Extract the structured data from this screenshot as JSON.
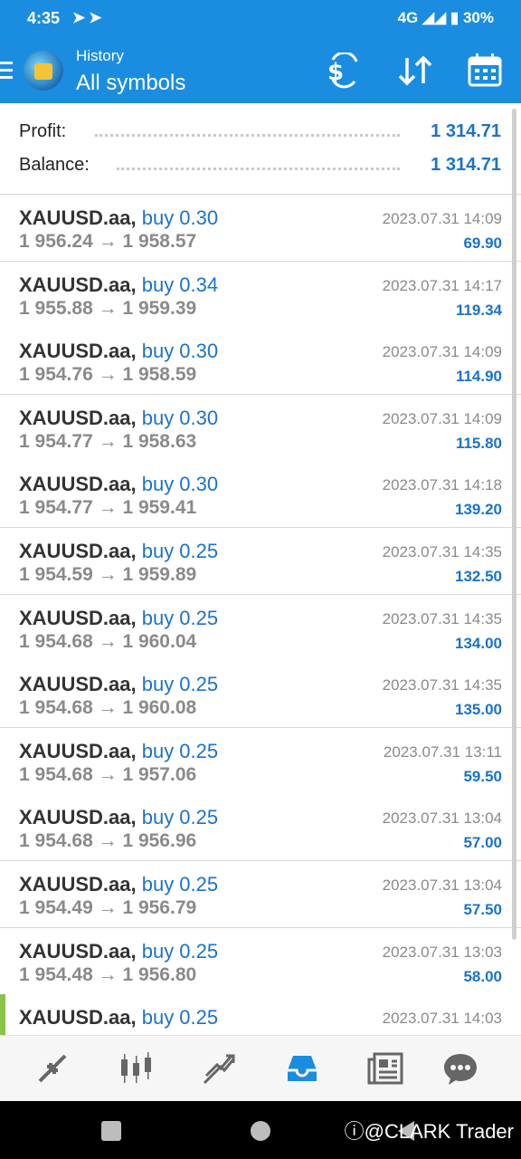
{
  "status_bar": {
    "time": "4:35",
    "network": "4G",
    "battery": "30%"
  },
  "app_bar": {
    "subtitle": "History",
    "title": "All symbols"
  },
  "summary": {
    "profit_label": "Profit:",
    "profit_value": "1 314.71",
    "balance_label": "Balance:",
    "balance_value": "1 314.71"
  },
  "trades": [
    {
      "symbol": "XAUUSD.aa,",
      "action": "buy 0.30",
      "open": "1 956.24",
      "close": "1 958.57",
      "time": "2023.07.31 14:09",
      "profit": "69.90"
    },
    {
      "symbol": "XAUUSD.aa,",
      "action": "buy 0.34",
      "open": "1 955.88",
      "close": "1 959.39",
      "time": "2023.07.31 14:17",
      "profit": "119.34"
    },
    {
      "symbol": "XAUUSD.aa,",
      "action": "buy 0.30",
      "open": "1 954.76",
      "close": "1 958.59",
      "time": "2023.07.31 14:09",
      "profit": "114.90"
    },
    {
      "symbol": "XAUUSD.aa,",
      "action": "buy 0.30",
      "open": "1 954.77",
      "close": "1 958.63",
      "time": "2023.07.31 14:09",
      "profit": "115.80"
    },
    {
      "symbol": "XAUUSD.aa,",
      "action": "buy 0.30",
      "open": "1 954.77",
      "close": "1 959.41",
      "time": "2023.07.31 14:18",
      "profit": "139.20"
    },
    {
      "symbol": "XAUUSD.aa,",
      "action": "buy 0.25",
      "open": "1 954.59",
      "close": "1 959.89",
      "time": "2023.07.31 14:35",
      "profit": "132.50"
    },
    {
      "symbol": "XAUUSD.aa,",
      "action": "buy 0.25",
      "open": "1 954.68",
      "close": "1 960.04",
      "time": "2023.07.31 14:35",
      "profit": "134.00"
    },
    {
      "symbol": "XAUUSD.aa,",
      "action": "buy 0.25",
      "open": "1 954.68",
      "close": "1 960.08",
      "time": "2023.07.31 14:35",
      "profit": "135.00"
    },
    {
      "symbol": "XAUUSD.aa,",
      "action": "buy 0.25",
      "open": "1 954.68",
      "close": "1 957.06",
      "time": "2023.07.31 13:11",
      "profit": "59.50"
    },
    {
      "symbol": "XAUUSD.aa,",
      "action": "buy 0.25",
      "open": "1 954.68",
      "close": "1 956.96",
      "time": "2023.07.31 13:04",
      "profit": "57.00"
    },
    {
      "symbol": "XAUUSD.aa,",
      "action": "buy 0.25",
      "open": "1 954.49",
      "close": "1 956.79",
      "time": "2023.07.31 13:04",
      "profit": "57.50"
    },
    {
      "symbol": "XAUUSD.aa,",
      "action": "buy 0.25",
      "open": "1 954.48",
      "close": "1 956.80",
      "time": "2023.07.31 13:03",
      "profit": "58.00"
    },
    {
      "symbol": "XAUUSD.aa,",
      "action": "buy 0.25",
      "open": "",
      "close": "",
      "time": "2023.07.31 14:03",
      "profit": ""
    }
  ],
  "bottom_nav": [
    "quotes-icon",
    "chart-icon",
    "trade-icon",
    "history-icon",
    "news-icon",
    "chat-icon"
  ],
  "watermark": "@CLARK Trader",
  "colors": {
    "primary": "#1a8de0",
    "link": "#1a73c8",
    "muted": "#8a8a8a"
  }
}
